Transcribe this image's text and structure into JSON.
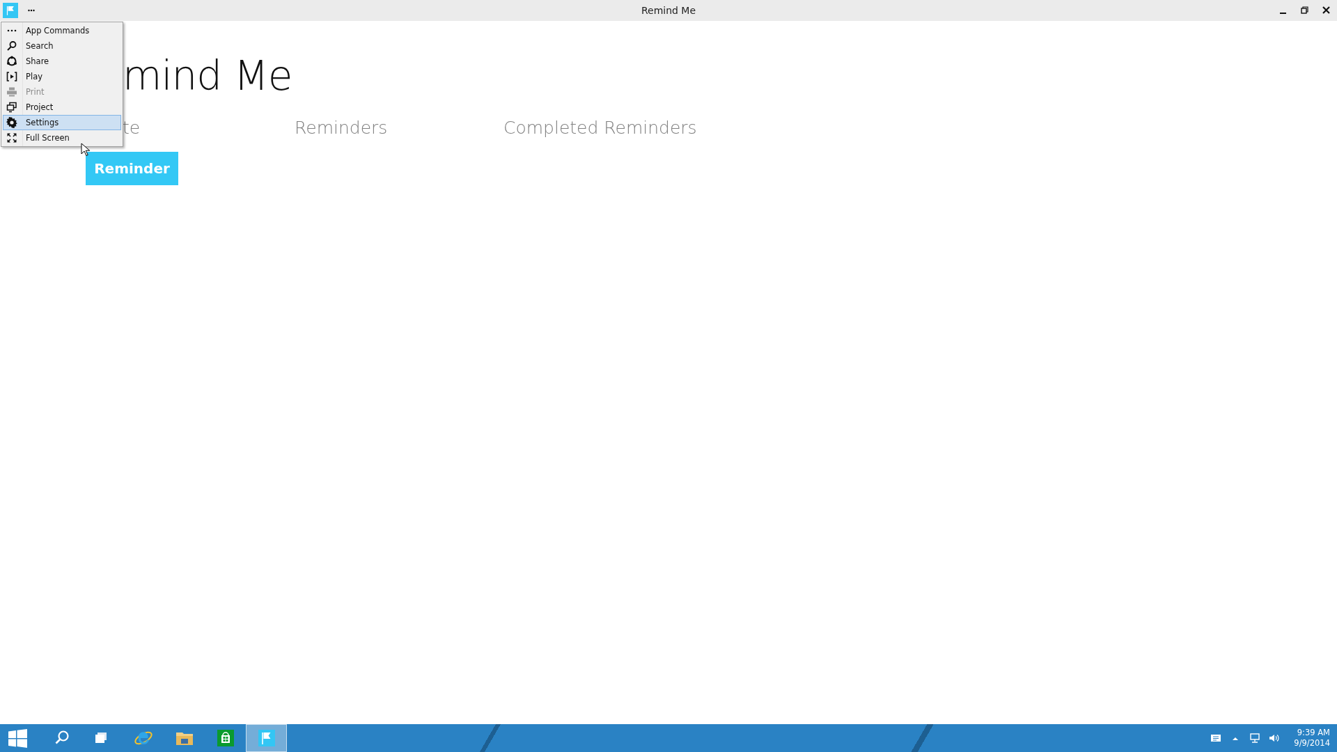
{
  "window": {
    "title": "Remind Me"
  },
  "app_menu": {
    "items": [
      {
        "label": "App Commands",
        "disabled": false,
        "selected": false
      },
      {
        "label": "Search",
        "disabled": false,
        "selected": false
      },
      {
        "label": "Share",
        "disabled": false,
        "selected": false
      },
      {
        "label": "Play",
        "disabled": false,
        "selected": false
      },
      {
        "label": "Print",
        "disabled": true,
        "selected": false
      },
      {
        "label": "Project",
        "disabled": false,
        "selected": false
      },
      {
        "label": "Settings",
        "disabled": false,
        "selected": true
      },
      {
        "label": "Full Screen",
        "disabled": false,
        "selected": false
      }
    ]
  },
  "page": {
    "heading": "mind Me",
    "pivot": [
      {
        "label": "te"
      },
      {
        "label": "Reminders"
      },
      {
        "label": "Completed Reminders"
      }
    ],
    "add_button": "Reminder"
  },
  "taskbar": {
    "apps": [
      {
        "selected": false
      },
      {
        "selected": false
      },
      {
        "selected": false
      },
      {
        "selected": false
      },
      {
        "selected": false
      },
      {
        "selected": true
      }
    ],
    "clock": {
      "time": "9:39 AM",
      "date": "9/9/2014"
    }
  }
}
